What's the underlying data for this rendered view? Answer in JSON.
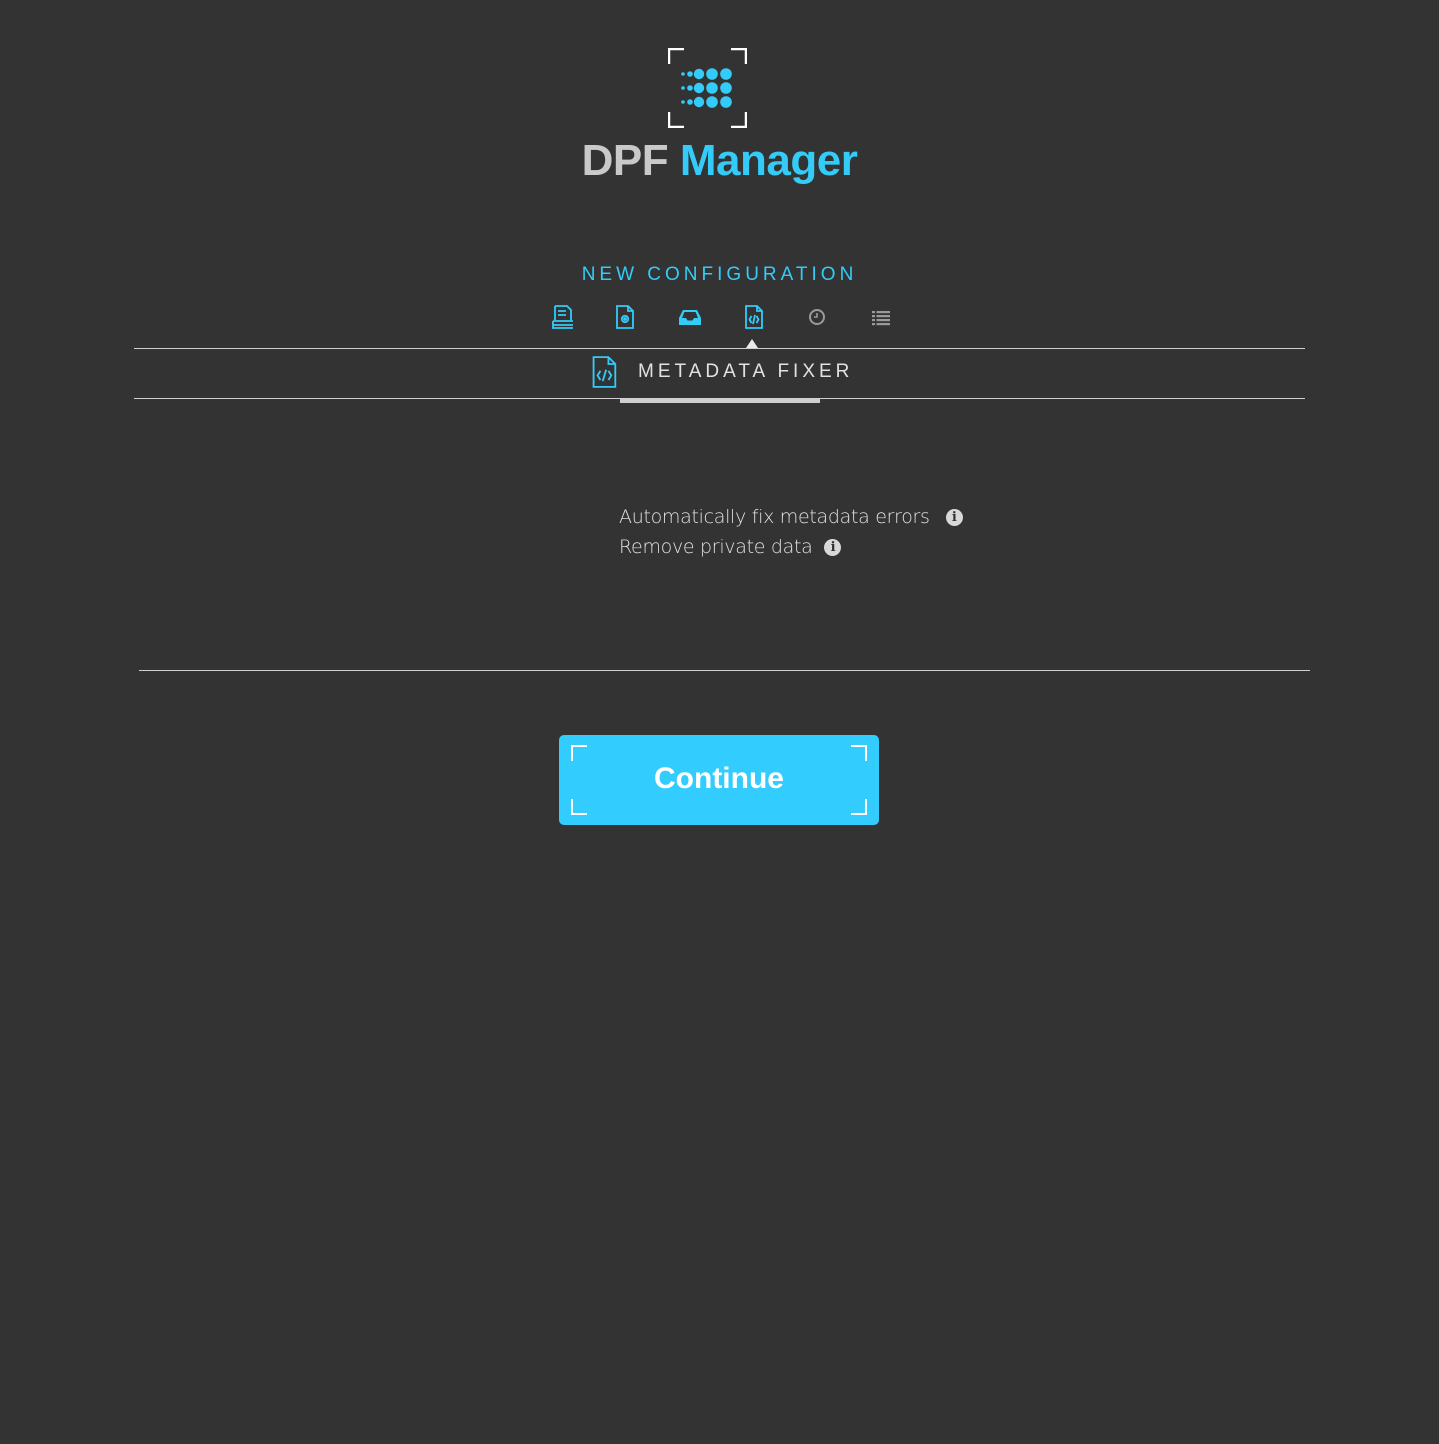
{
  "app": {
    "name_part1": "DPF",
    "name_part2": "Manager",
    "accent_color": "#33ccf9",
    "background_color": "#333333"
  },
  "wizard": {
    "title": "NEW CONFIGURATION",
    "steps": [
      {
        "icon": "file-text-icon",
        "state": "done"
      },
      {
        "icon": "file-settings-icon",
        "state": "done"
      },
      {
        "icon": "inbox-tray-icon",
        "state": "done"
      },
      {
        "icon": "file-code-icon",
        "state": "active"
      },
      {
        "icon": "clock-icon",
        "state": "pending"
      },
      {
        "icon": "list-icon",
        "state": "pending"
      }
    ]
  },
  "tab": {
    "icon": "file-code-icon",
    "label": "METADATA FIXER"
  },
  "options": [
    {
      "label": "Automatically fix metadata errors",
      "info_icon": "info-icon"
    },
    {
      "label": "Remove private data",
      "info_icon": "info-icon"
    }
  ],
  "actions": {
    "continue_label": "Continue"
  }
}
